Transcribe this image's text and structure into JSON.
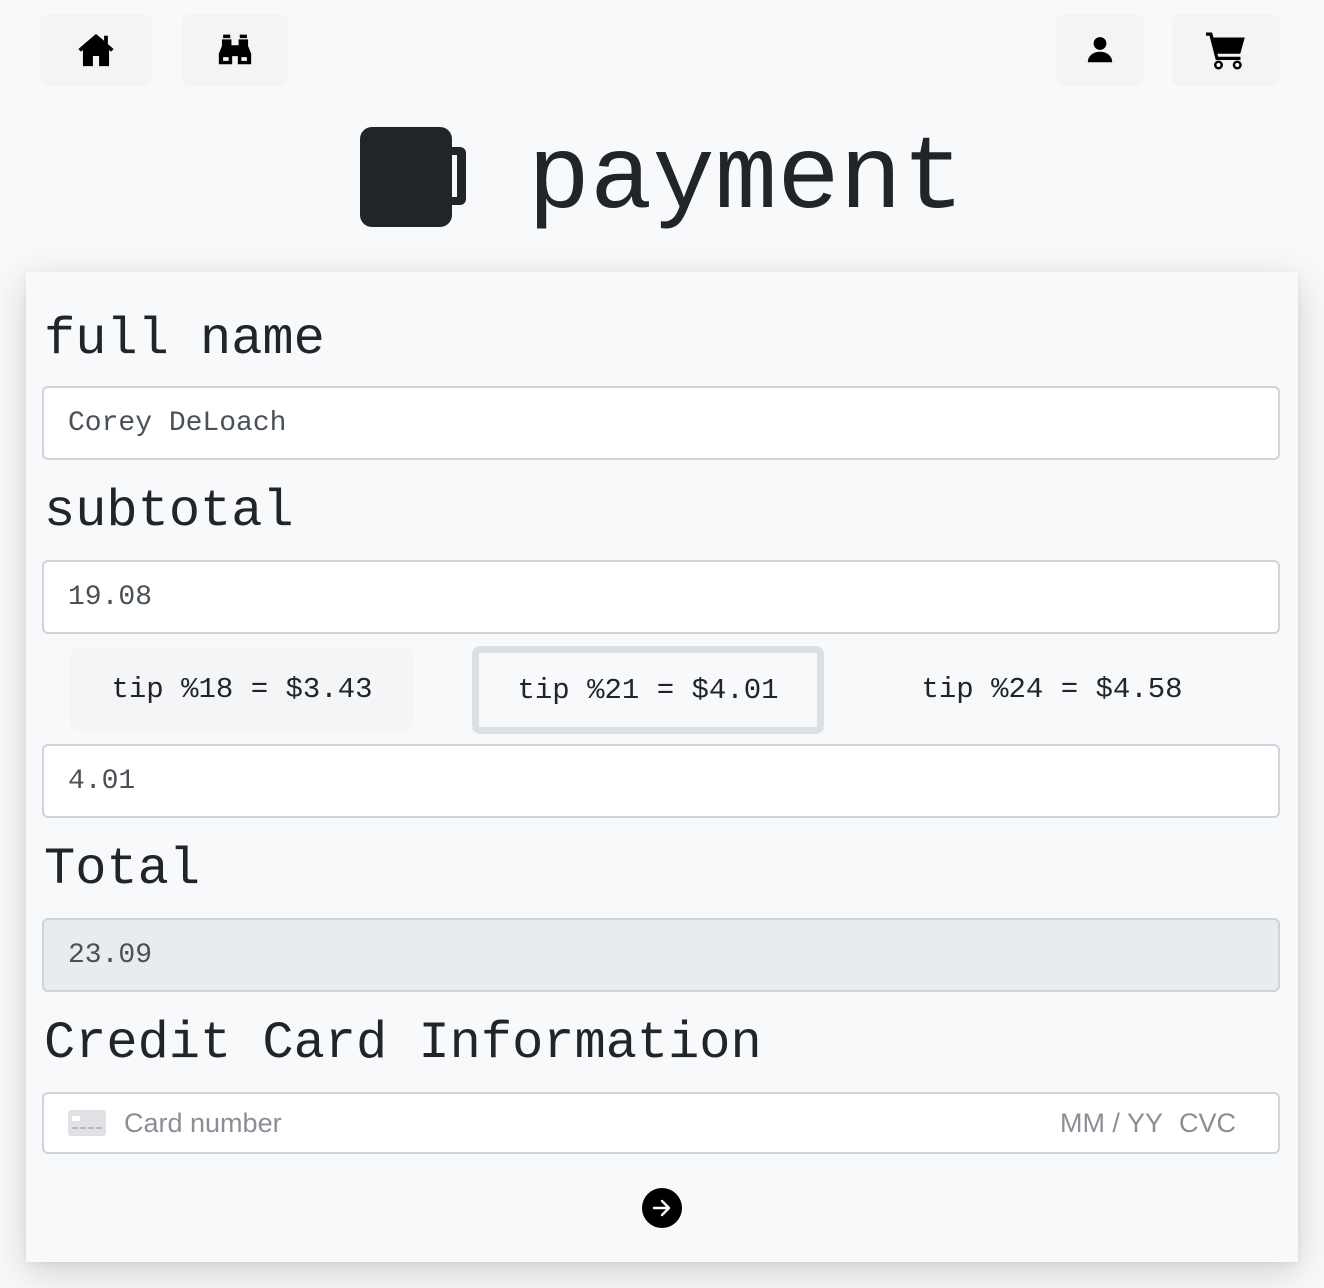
{
  "nav": {
    "home_icon": "home-icon",
    "browse_icon": "binoculars-icon",
    "account_icon": "person-icon",
    "cart_icon": "cart-icon"
  },
  "header": {
    "icon": "mug-icon",
    "title": "payment"
  },
  "form": {
    "full_name_label": "full name",
    "full_name_value": "Corey DeLoach",
    "subtotal_label": "subtotal",
    "subtotal_value": "19.08",
    "tips": [
      {
        "label": "tip %18 = $3.43",
        "selected": false
      },
      {
        "label": "tip %21 = $4.01",
        "selected": true
      },
      {
        "label": "tip %24 = $4.58",
        "selected": false
      }
    ],
    "tip_value": "4.01",
    "total_label": "Total",
    "total_value": "23.09",
    "credit_card_label": "Credit Card Information",
    "card_number_placeholder": "Card number",
    "expiry_placeholder": "MM / YY",
    "cvc_placeholder": "CVC",
    "submit_icon": "arrow-right-circle-icon"
  },
  "colors": {
    "background": "#f8f9fa",
    "text": "#212529",
    "input_border": "#ced4da",
    "readonly_bg": "#e9ecef",
    "selected_tip_border": "#dcdfe3"
  }
}
